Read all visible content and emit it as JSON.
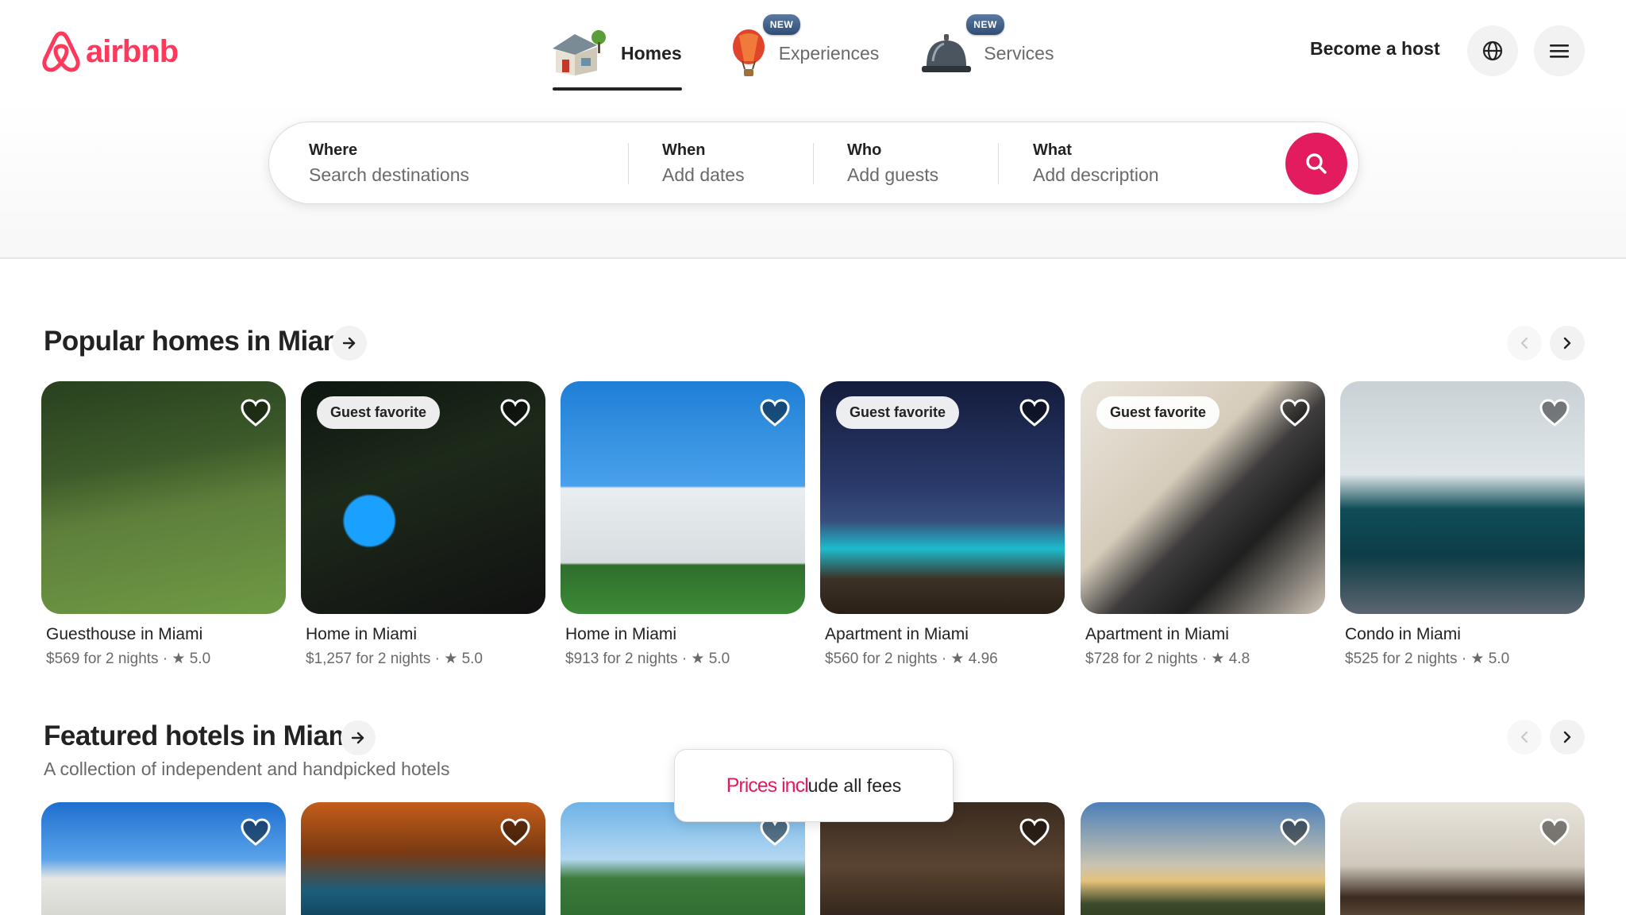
{
  "header": {
    "logo_text": "airbnb",
    "brand_color": "#ff385c",
    "tabs": [
      {
        "label": "Homes",
        "icon": "house-icon",
        "active": true,
        "badge": ""
      },
      {
        "label": "Experiences",
        "icon": "hot-air-balloon-icon",
        "active": false,
        "badge": "NEW"
      },
      {
        "label": "Services",
        "icon": "service-bell-icon",
        "active": false,
        "badge": "NEW"
      }
    ],
    "become_host": "Become a host",
    "globe_icon": "globe-icon",
    "menu_icon": "hamburger-menu-icon"
  },
  "search": {
    "where": {
      "label": "Where",
      "placeholder": "Search destinations"
    },
    "when": {
      "label": "When",
      "placeholder": "Add dates"
    },
    "who": {
      "label": "Who",
      "placeholder": "Add guests"
    },
    "what": {
      "label": "What",
      "placeholder": "Add description"
    },
    "button_icon": "search-icon",
    "button_color": "#e31c5f"
  },
  "popular": {
    "title": "Popular homes in Miami",
    "listings": [
      {
        "title": "Guesthouse in Miami",
        "meta": "$569 for 2 nights · ★ 5.0",
        "badge": ""
      },
      {
        "title": "Home in Miami",
        "meta": "$1,257 for 2 nights · ★ 5.0",
        "badge": "Guest favorite"
      },
      {
        "title": "Home in Miami",
        "meta": "$913 for 2 nights · ★ 5.0",
        "badge": ""
      },
      {
        "title": "Apartment in Miami",
        "meta": "$560 for 2 nights · ★ 4.96",
        "badge": "Guest favorite"
      },
      {
        "title": "Apartment in Miami",
        "meta": "$728 for 2 nights · ★ 4.8",
        "badge": "Guest favorite"
      },
      {
        "title": "Condo in Miami",
        "meta": "$525 for 2 nights · ★ 5.0",
        "badge": ""
      }
    ]
  },
  "featured": {
    "title": "Featured hotels in Miami",
    "subtitle": "A collection of independent and handpicked hotels"
  },
  "toast": {
    "part1": "Prices incl",
    "part2": "ude all fees"
  }
}
